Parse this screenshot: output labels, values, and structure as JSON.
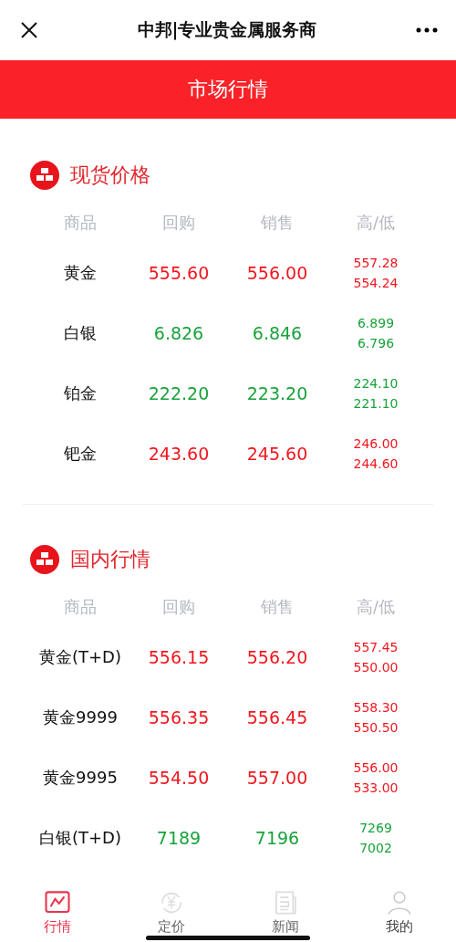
{
  "top_bar": {
    "title": "中邦|专业贵金属服务商"
  },
  "banner": {
    "title": "市场行情"
  },
  "sections": [
    {
      "title": "现货价格",
      "columns": [
        "商品",
        "回购",
        "销售",
        "高/低"
      ],
      "rows": [
        {
          "name": "黄金",
          "buy": "555.60",
          "sell": "556.00",
          "high": "557.28",
          "low": "554.24",
          "color": "#f2161e"
        },
        {
          "name": "白银",
          "buy": "6.826",
          "sell": "6.846",
          "high": "6.899",
          "low": "6.796",
          "color": "#18a23a"
        },
        {
          "name": "铂金",
          "buy": "222.20",
          "sell": "223.20",
          "high": "224.10",
          "low": "221.10",
          "color": "#18a23a"
        },
        {
          "name": "钯金",
          "buy": "243.60",
          "sell": "245.60",
          "high": "246.00",
          "low": "244.60",
          "color": "#f2161e"
        }
      ]
    },
    {
      "title": "国内行情",
      "columns": [
        "商品",
        "回购",
        "销售",
        "高/低"
      ],
      "rows": [
        {
          "name": "黄金(T+D)",
          "buy": "556.15",
          "sell": "556.20",
          "high": "557.45",
          "low": "550.00",
          "color": "#f2161e"
        },
        {
          "name": "黄金9999",
          "buy": "556.35",
          "sell": "556.45",
          "high": "558.30",
          "low": "550.50",
          "color": "#f2161e"
        },
        {
          "name": "黄金9995",
          "buy": "554.50",
          "sell": "557.00",
          "high": "556.00",
          "low": "533.00",
          "color": "#f2161e"
        },
        {
          "name": "白银(T+D)",
          "buy": "7189",
          "sell": "7196",
          "high": "7269",
          "low": "7002",
          "color": "#18a23a"
        }
      ]
    }
  ],
  "tab_bar": [
    {
      "label": "行情",
      "kind": "chart",
      "selected": true
    },
    {
      "label": "定价",
      "kind": "yuan",
      "selected": false
    },
    {
      "label": "新闻",
      "kind": "news",
      "selected": false
    },
    {
      "label": "我的",
      "kind": "person",
      "selected": false
    }
  ]
}
